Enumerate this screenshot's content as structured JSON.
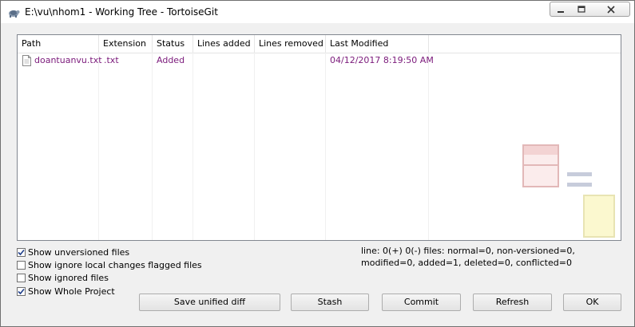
{
  "window": {
    "title": "E:\\vu\\nhom1 - Working Tree - TortoiseGit"
  },
  "columns": [
    "Path",
    "Extension",
    "Status",
    "Lines added",
    "Lines removed",
    "Last Modified"
  ],
  "files": [
    {
      "path": "doantuanvu.txt",
      "extension": ".txt",
      "status": "Added",
      "lines_added": "",
      "lines_removed": "",
      "last_modified": "04/12/2017 8:19:50 AM"
    }
  ],
  "options": {
    "show_unversioned": {
      "label": "Show unversioned files",
      "checked": true
    },
    "show_ignore_local": {
      "label": "Show ignore local changes flagged files",
      "checked": false
    },
    "show_ignored": {
      "label": "Show ignored files",
      "checked": false
    },
    "show_whole_project": {
      "label": "Show Whole Project",
      "checked": true
    }
  },
  "status_text": "line: 0(+) 0(-) files: normal=0, non-versioned=0, modified=0, added=1, deleted=0, conflicted=0",
  "buttons": {
    "save_diff": "Save unified diff",
    "stash": "Stash",
    "commit": "Commit",
    "refresh": "Refresh",
    "ok": "OK"
  },
  "colors": {
    "added_file_text": "#7b1a7b"
  }
}
